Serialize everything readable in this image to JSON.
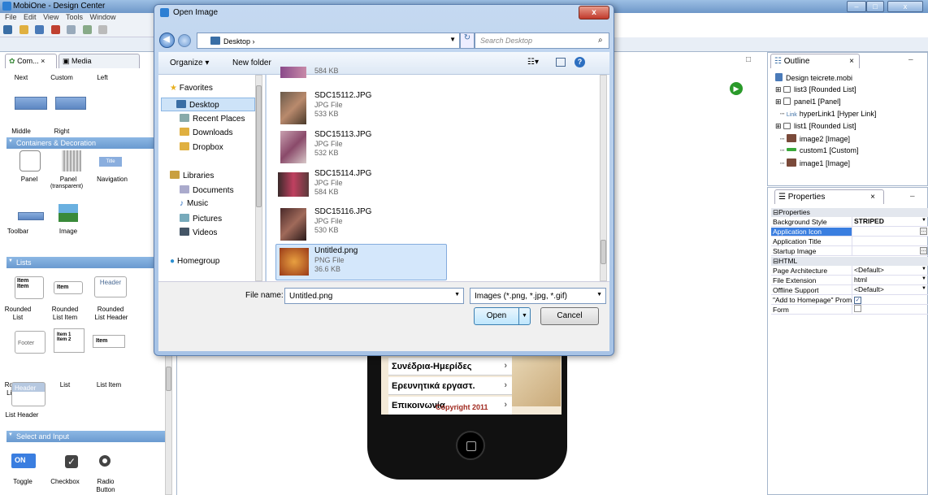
{
  "app": {
    "title": "MobiOne - Design Center"
  },
  "menu": [
    "File",
    "Edit",
    "View",
    "Tools",
    "Window"
  ],
  "palette": {
    "tabs": [
      {
        "label": "Com..."
      },
      {
        "label": "Media"
      }
    ],
    "top_labels": [
      "Next",
      "Custom",
      "Left"
    ],
    "mid_labels": [
      "Middle",
      "Right"
    ],
    "sections": [
      "Containers & Decoration",
      "Lists",
      "Select and Input"
    ],
    "containers": [
      "Panel",
      "Panel",
      "(transparent)",
      "Navigation",
      "Toolbar",
      "Image"
    ],
    "nav_title": "Title",
    "list_item": "Item",
    "list_header": "Header",
    "lists": [
      "Rounded",
      "List",
      "Rounded",
      "List Item",
      "Rounded",
      "List Header"
    ],
    "list_item2": [
      "Item 1",
      "Item 2"
    ],
    "footer": "Footer",
    "lists2": [
      "Rounded",
      "List Footer",
      "List",
      "List Item"
    ],
    "header2": "Header",
    "list_header2": "List Header",
    "inputs": [
      "Toggle",
      "Checkbox",
      "Radio",
      "Button"
    ],
    "toggle": "ON"
  },
  "phone": {
    "items": [
      "Συνέδρια-Ημερίδες",
      "Ερευνητικά εργαστ.",
      "Επικοινωνία"
    ],
    "copyright": "Copyright 2011"
  },
  "outline": {
    "tab": "Outline",
    "root": "Design teicrete.mobi",
    "items": [
      "list3 [Rounded List]",
      "panel1 [Panel]",
      "hyperLink1 [Hyper Link]",
      "list1 [Rounded List]",
      "image2 [Image]",
      "custom1 [Custom]",
      "image1 [Image]"
    ],
    "link_prefix": "Link"
  },
  "properties": {
    "tab": "Properties",
    "group1": "Properties",
    "rows1": [
      {
        "n": "Background Style",
        "v": "STRIPED"
      },
      {
        "n": "Application Icon",
        "v": ""
      },
      {
        "n": "Application Title",
        "v": ""
      },
      {
        "n": "Startup Image",
        "v": ""
      }
    ],
    "group2": "HTML",
    "rows2": [
      {
        "n": "Page Architecture",
        "v": "<Default>"
      },
      {
        "n": "File Extension",
        "v": "html"
      },
      {
        "n": "Offline Support",
        "v": "<Default>"
      },
      {
        "n": "\"Add to Homepage\" Prom",
        "v": ""
      },
      {
        "n": "Form",
        "v": ""
      }
    ]
  },
  "dialog": {
    "title": "Open Image",
    "close": "x",
    "address": "Desktop",
    "search_placeholder": "Search Desktop",
    "organize": "Organize ▾",
    "new_folder": "New folder",
    "favorites": "Favorites",
    "fav_items": [
      "Desktop",
      "Recent Places",
      "Downloads",
      "Dropbox"
    ],
    "libraries": "Libraries",
    "lib_items": [
      "Documents",
      "Music",
      "Pictures",
      "Videos"
    ],
    "homegroup": "Homegroup",
    "files": [
      {
        "name": "",
        "type": "",
        "size": "584 KB"
      },
      {
        "name": "SDC15112.JPG",
        "type": "JPG File",
        "size": "533 KB"
      },
      {
        "name": "SDC15113.JPG",
        "type": "JPG File",
        "size": "532 KB"
      },
      {
        "name": "SDC15114.JPG",
        "type": "JPG File",
        "size": "584 KB"
      },
      {
        "name": "SDC15116.JPG",
        "type": "JPG File",
        "size": "530 KB"
      },
      {
        "name": "Untitled.png",
        "type": "PNG File",
        "size": "36.6 KB"
      }
    ],
    "filename_label": "File name:",
    "filename": "Untitled.png",
    "filter": "Images (*.png, *.jpg, *.gif)",
    "open": "Open",
    "cancel": "Cancel"
  }
}
